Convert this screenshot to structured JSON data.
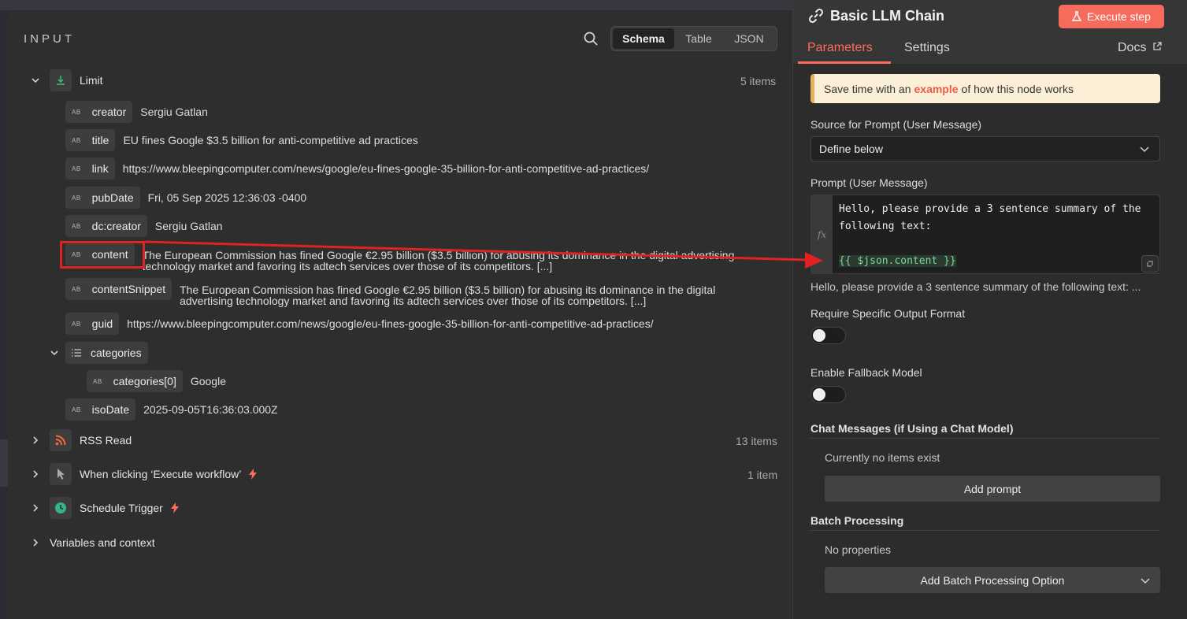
{
  "input_panel": {
    "title": "INPUT",
    "view_options": [
      "Schema",
      "Table",
      "JSON"
    ],
    "active_view": "Schema",
    "limit_node": {
      "label": "Limit",
      "count": "5 items",
      "fields": [
        {
          "key": "creator",
          "value": "Sergiu Gatlan"
        },
        {
          "key": "title",
          "value": "EU fines Google $3.5 billion for anti-competitive ad practices"
        },
        {
          "key": "link",
          "value": "https://www.bleepingcomputer.com/news/google/eu-fines-google-35-billion-for-anti-competitive-ad-practices/"
        },
        {
          "key": "pubDate",
          "value": "Fri, 05 Sep 2025 12:36:03 -0400"
        },
        {
          "key": "dc:creator",
          "value": "Sergiu Gatlan"
        },
        {
          "key": "content",
          "value_line1": "The European Commission has fined Google €2.95 billion ($3.5 billion) for abusing its dominance in the digital advertising",
          "value_line2": "technology market and favoring its adtech services over those of its competitors. [...]"
        },
        {
          "key": "contentSnippet",
          "value_line1": "The European Commission has fined Google €2.95 billion ($3.5 billion) for abusing its dominance in the digital",
          "value_line2": "advertising technology market and favoring its adtech services over those of its competitors. [...]"
        },
        {
          "key": "guid",
          "value": "https://www.bleepingcomputer.com/news/google/eu-fines-google-35-billion-for-anti-competitive-ad-practices/"
        },
        {
          "key": "categories"
        },
        {
          "key": "categories[0]",
          "value": "Google"
        },
        {
          "key": "isoDate",
          "value": "2025-09-05T16:36:03.000Z"
        }
      ]
    },
    "other_nodes": [
      {
        "label": "RSS Read",
        "count": "13 items"
      },
      {
        "label": "When clicking ‘Execute workflow’",
        "count": "1 item"
      },
      {
        "label": "Schedule Trigger",
        "count": ""
      },
      {
        "label": "Variables and context",
        "count": ""
      }
    ],
    "type_badge": "AB"
  },
  "node_panel": {
    "title": "Basic LLM Chain",
    "execute_label": "Execute step",
    "tabs": {
      "parameters": "Parameters",
      "settings": "Settings",
      "docs": "Docs"
    },
    "callout": {
      "prefix": "Save time with an",
      "link": "example",
      "suffix": "of how this node works"
    },
    "source_label": "Source for Prompt (User Message)",
    "source_value": "Define below",
    "prompt_label": "Prompt (User Message)",
    "prompt_line1": "Hello, please provide a 3 sentence summary of the",
    "prompt_line2": "following text:",
    "prompt_expr": "{{ $json.content }}",
    "fx": "fx",
    "prompt_preview": "Hello, please provide a 3 sentence summary of the following text: ...",
    "require_format_label": "Require Specific Output Format",
    "require_format_on": false,
    "fallback_label": "Enable Fallback Model",
    "fallback_on": false,
    "chat_messages_title": "Chat Messages (if Using a Chat Model)",
    "chat_messages_empty": "Currently no items exist",
    "add_prompt_label": "Add prompt",
    "batch_title": "Batch Processing",
    "batch_empty": "No properties",
    "add_batch_label": "Add Batch Processing Option"
  },
  "colors": {
    "accent": "#ff6d5a",
    "annotation": "#e02222",
    "expression": "#7ed79c"
  }
}
